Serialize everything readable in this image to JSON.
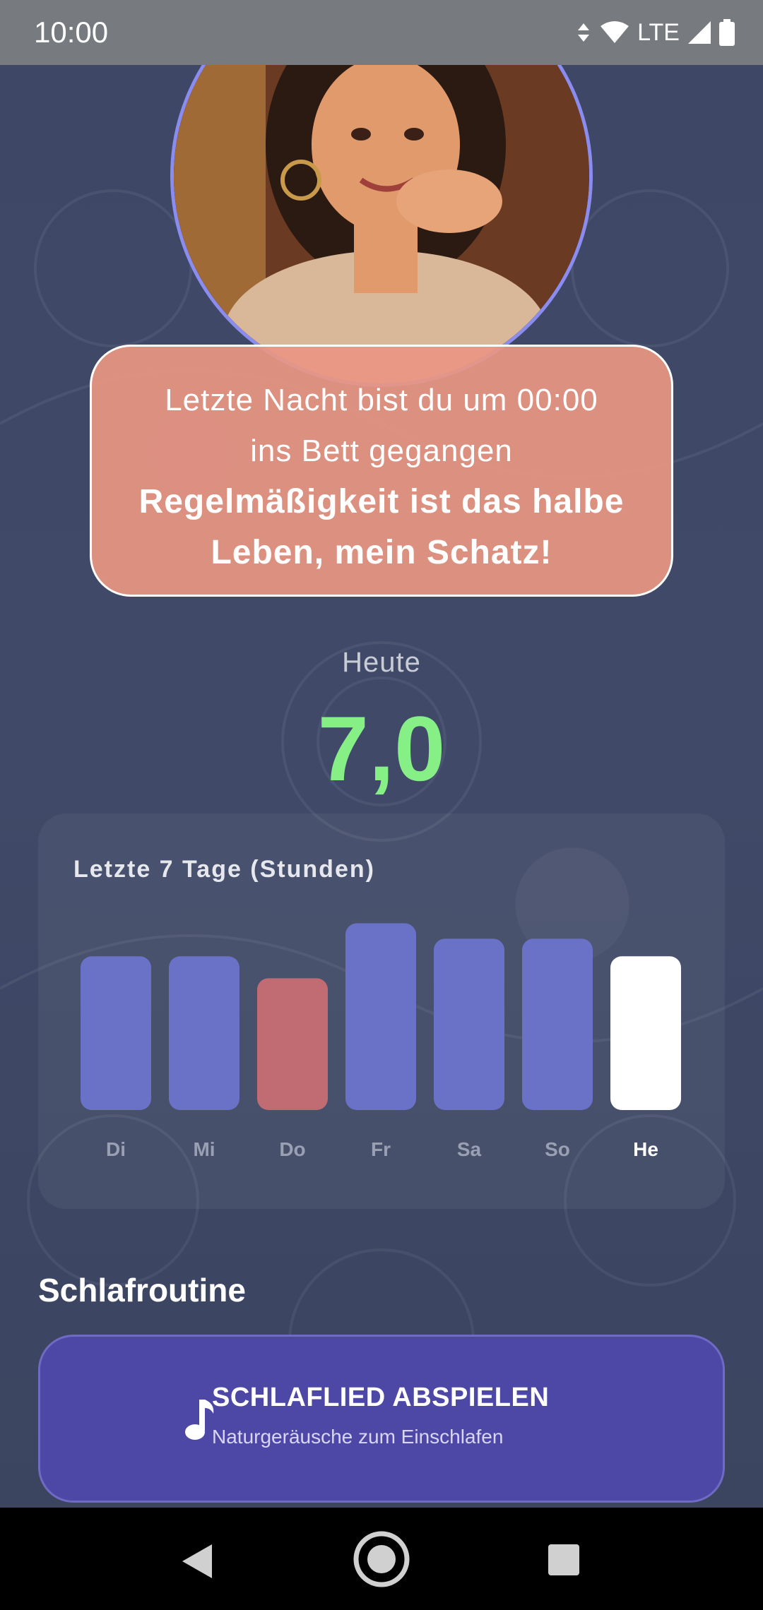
{
  "status_bar": {
    "time": "10:00",
    "network": "LTE"
  },
  "avatar": {
    "icon": "avatar-portrait"
  },
  "message": {
    "line1": "Letzte Nacht bist du um 00:00",
    "line2": "ins Bett gegangen",
    "emphasis1": "Regelmäßigkeit ist das halbe",
    "emphasis2": "Leben, mein Schatz!"
  },
  "today": {
    "label": "Heute",
    "value": "7,0",
    "color": "#86ef86"
  },
  "chart_data": {
    "type": "bar",
    "title": "Letzte 7 Tage (Stunden)",
    "categories": [
      "Di",
      "Mi",
      "Do",
      "Fr",
      "Sa",
      "So",
      "He"
    ],
    "values": [
      7.0,
      7.0,
      6.0,
      8.5,
      7.8,
      7.8,
      7.0
    ],
    "colors": [
      "#6a72c8",
      "#6a72c8",
      "#c06c72",
      "#6a72c8",
      "#6a72c8",
      "#6a72c8",
      "#ffffff"
    ],
    "highlight_index": 6,
    "ylim": [
      0,
      9
    ]
  },
  "routine": {
    "section_title": "Schlafroutine",
    "lullaby_title": "SCHLAFLIED ABSPIELEN",
    "lullaby_subtitle": "Naturgeräusche zum Einschlafen",
    "lullaby_icon": "music-note-icon"
  },
  "nav": {
    "back": "back-icon",
    "home": "home-icon",
    "recents": "recents-icon"
  }
}
